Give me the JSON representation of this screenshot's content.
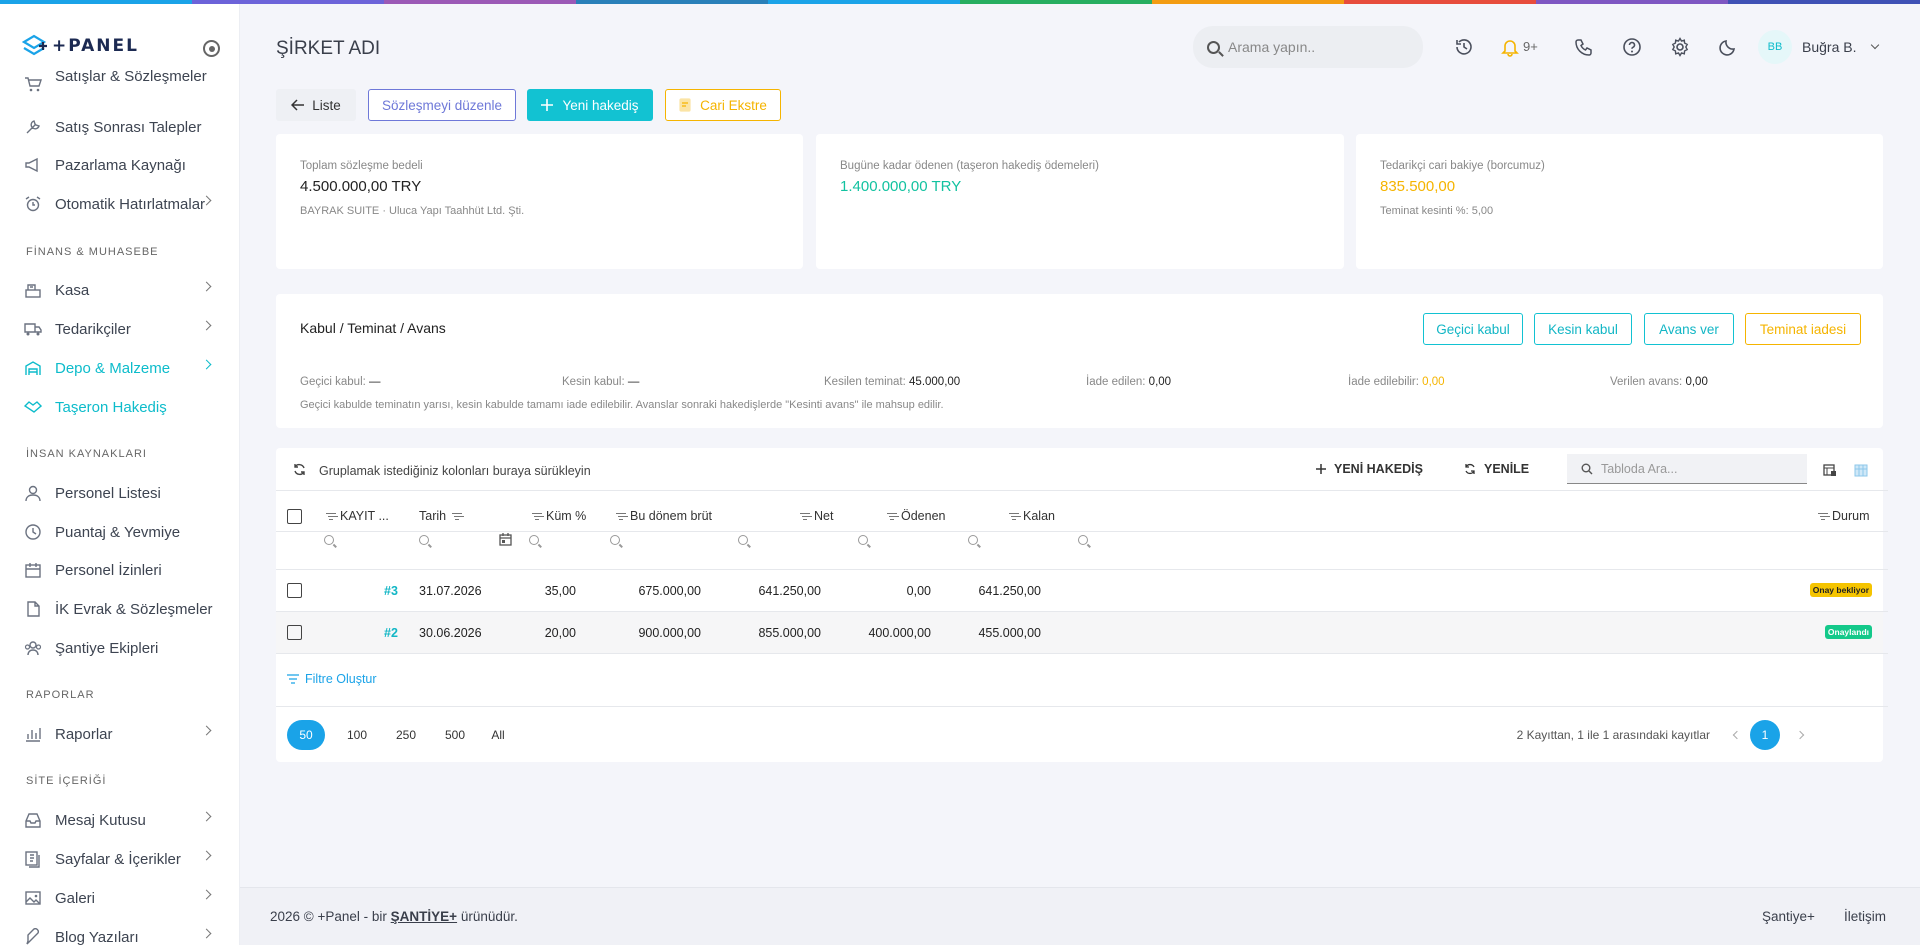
{
  "colors": {
    "accent": "#12c2d2",
    "warning": "#f5b400",
    "stripe": [
      "#1aa3e8",
      "#6c63d9",
      "#9b59b6",
      "#2980b9",
      "#1aa3e8",
      "#27ae60",
      "#f39c12",
      "#e74c3c",
      "#7e57c2",
      "#3f51b5"
    ]
  },
  "sidebar": {
    "brand": "+PANEL",
    "items_top": [
      {
        "label": "Satışlar & Sözleşmeler",
        "icon": "cart-icon"
      },
      {
        "label": "Satış Sonrası Talepler",
        "icon": "tools-icon"
      },
      {
        "label": "Pazarlama Kaynağı",
        "icon": "megaphone-icon"
      },
      {
        "label": "Otomatik Hatırlatmalar",
        "icon": "alarm-icon"
      }
    ],
    "section_finance": "FİNANS & MUHASEBE",
    "items_finance": [
      {
        "label": "Kasa",
        "icon": "cash-register-icon"
      },
      {
        "label": "Tedarikçiler",
        "icon": "truck-icon"
      },
      {
        "label": "Depo & Malzeme",
        "icon": "warehouse-icon"
      },
      {
        "label": "Taşeron Hakediş",
        "icon": "handshake-icon"
      }
    ],
    "section_hr": "İNSAN KAYNAKLARI",
    "items_hr": [
      {
        "label": "Personel Listesi",
        "icon": "user-icon"
      },
      {
        "label": "Puantaj & Yevmiye",
        "icon": "clock-icon"
      },
      {
        "label": "Personel İzinleri",
        "icon": "calendar-icon"
      },
      {
        "label": "İK Evrak & Sözleşmeler",
        "icon": "document-icon"
      },
      {
        "label": "Şantiye Ekipleri",
        "icon": "team-icon"
      }
    ],
    "section_reports": "RAPORLAR",
    "items_reports": [
      {
        "label": "Raporlar",
        "icon": "chart-icon"
      }
    ],
    "section_site": "SİTE İÇERİĞİ",
    "items_site": [
      {
        "label": "Mesaj Kutusu",
        "icon": "inbox-icon"
      },
      {
        "label": "Sayfalar & İçerikler",
        "icon": "pages-icon"
      },
      {
        "label": "Galeri",
        "icon": "gallery-icon"
      },
      {
        "label": "Blog Yazıları",
        "icon": "feather-icon"
      }
    ]
  },
  "header": {
    "company": "ŞİRKET ADI",
    "search_placeholder": "Arama yapın..",
    "notifications": "9+",
    "avatar_initials": "BB",
    "user_name": "Buğra B."
  },
  "toolbar": {
    "list": "Liste",
    "edit_contract": "Sözleşmeyi düzenle",
    "new_progress": "Yeni hakediş",
    "account_statement": "Cari Ekstre"
  },
  "summary": {
    "total_label": "Toplam sözleşme bedeli",
    "total_value": "4.500.000,00 TRY",
    "project": "BAYRAK SUITE · Uluca Yapı Taahhüt Ltd. Şti.",
    "paid_label": "Bugüne kadar ödenen (taşeron hakediş ödemeleri)",
    "paid_value": "1.400.000,00 TRY",
    "balance_label": "Tedarikçi cari bakiye (borcumuz)",
    "balance_value": "835.500,00",
    "retention_label": "Teminat kesinti %: 5,00"
  },
  "acceptance": {
    "title": "Kabul / Teminat / Avans",
    "btn_provisional": "Geçici kabul",
    "btn_final": "Kesin kabul",
    "btn_advance": "Avans ver",
    "btn_return": "Teminat iadesi",
    "stats": [
      {
        "label": "Geçici kabul:",
        "value": "—"
      },
      {
        "label": "Kesin kabul:",
        "value": "—"
      },
      {
        "label": "Kesilen teminat:",
        "value": "45.000,00"
      },
      {
        "label": "İade edilen:",
        "value": "0,00"
      },
      {
        "label": "İade edilebilir:",
        "value": "0,00"
      },
      {
        "label": "Verilen avans:",
        "value": "0,00"
      }
    ],
    "note": "Geçici kabulde teminatın yarısı, kesin kabulde tamamı iade edilebilir. Avanslar sonraki hakedişlerde \"Kesinti avans\" ile mahsup edilir."
  },
  "grid": {
    "group_hint": "Gruplamak istediğiniz kolonları buraya sürükleyin",
    "new_btn": "YENİ HAKEDİŞ",
    "refresh_btn": "YENİLE",
    "search_placeholder": "Tabloda Ara...",
    "columns": [
      "KAYIT ...",
      "Tarih",
      "Küm %",
      "Bu dönem brüt",
      "Net",
      "Ödenen",
      "Kalan",
      "Durum"
    ],
    "rows": [
      {
        "no": "#3",
        "date": "31.07.2026",
        "cum": "35,00",
        "gross": "675.000,00",
        "net": "641.250,00",
        "paid": "0,00",
        "rest": "641.250,00",
        "status": "Onay bekliyor"
      },
      {
        "no": "#2",
        "date": "30.06.2026",
        "cum": "20,00",
        "gross": "900.000,00",
        "net": "855.000,00",
        "paid": "400.000,00",
        "rest": "455.000,00",
        "status": "Onaylandı"
      }
    ],
    "filter_create": "Filtre Oluştur",
    "page_sizes": [
      "50",
      "100",
      "250",
      "500",
      "All"
    ],
    "records_info": "2 Kayıttan, 1 ile 1 arasındaki kayıtlar",
    "current_page": "1"
  },
  "footer": {
    "copyright_prefix": "2026 © +Panel - bir",
    "brand_link": "ŞANTİYE+",
    "copyright_suffix": "ürünüdür.",
    "link1": "Şantiye+",
    "link2": "İletişim"
  }
}
